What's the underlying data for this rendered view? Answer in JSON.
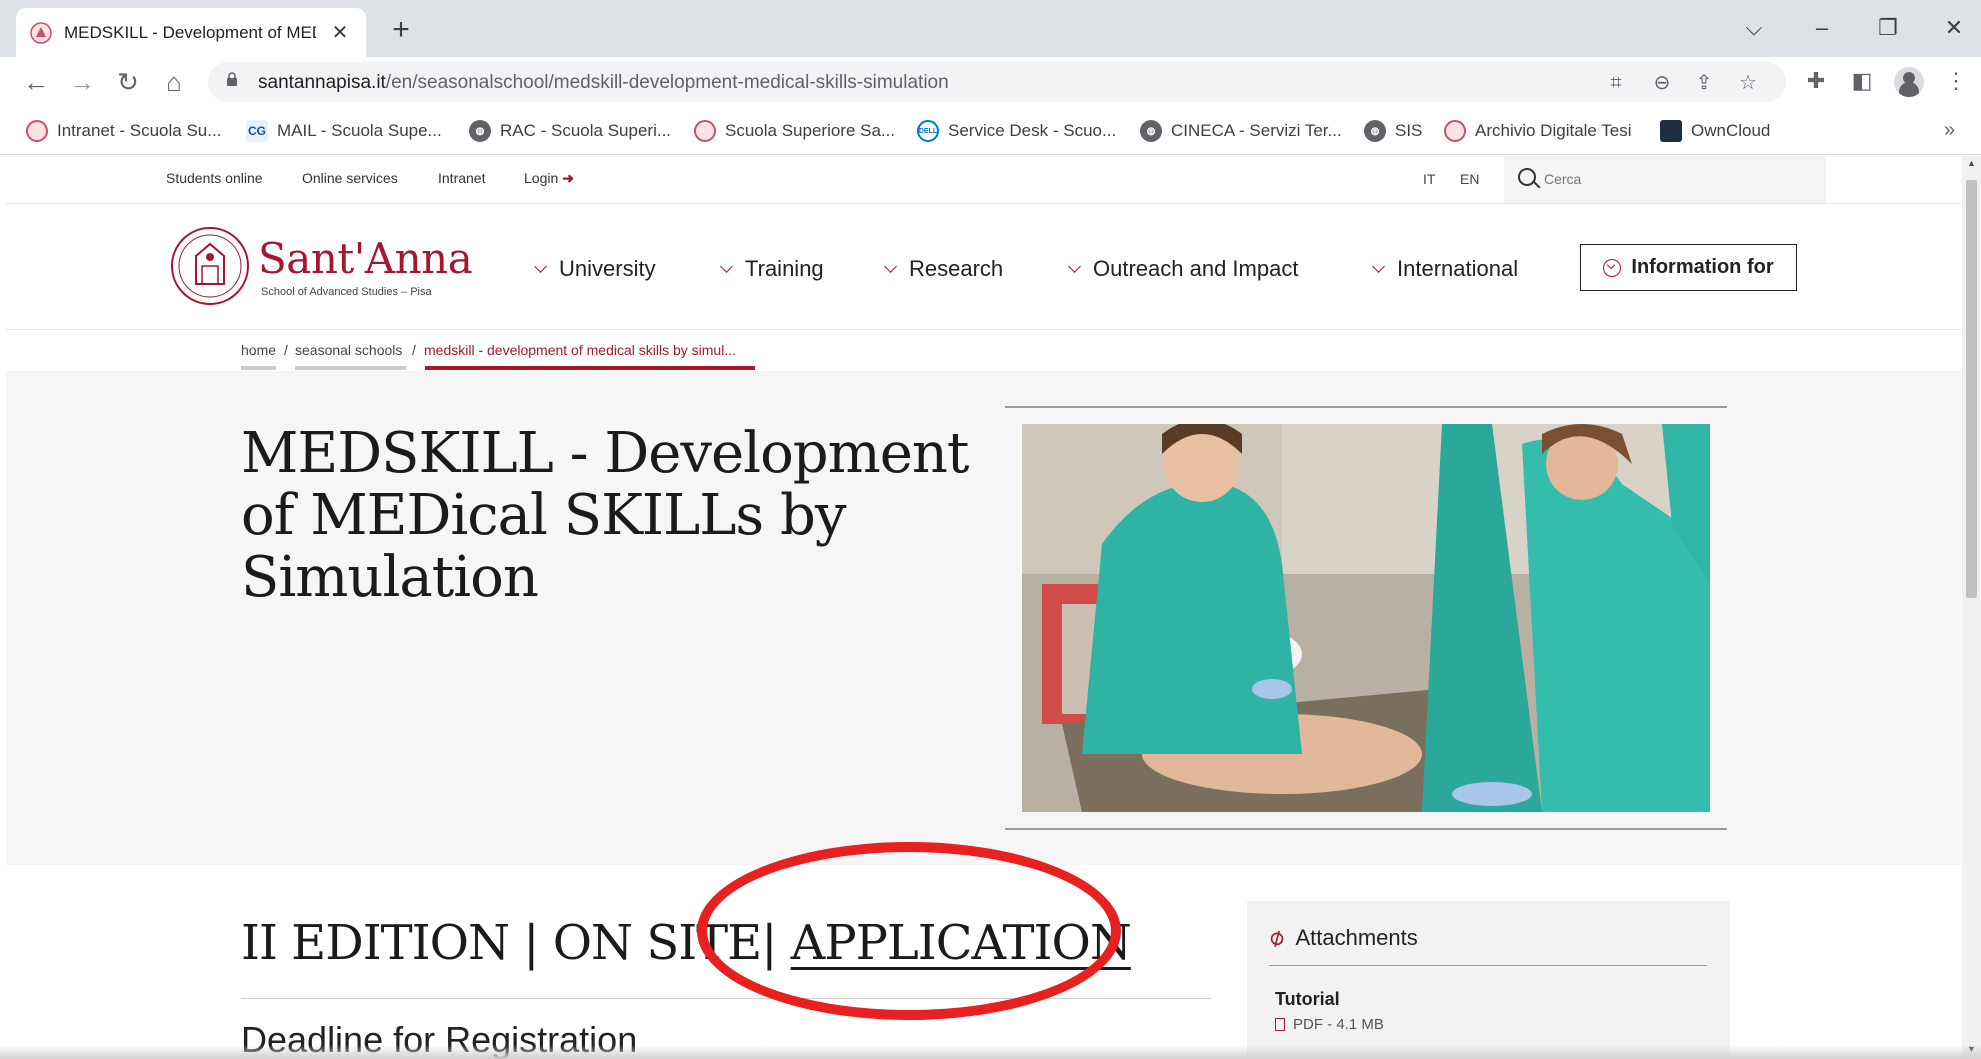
{
  "browser": {
    "tab_title": "MEDSKILL - Development of MEDSKILL",
    "url_host": "santannapisa.it",
    "url_path": "/en/seasonalschool/medskill-development-medical-skills-simulation",
    "bookmarks": [
      {
        "label": "Intranet - Scuola Su...",
        "icon": "crest-icon"
      },
      {
        "label": "MAIL - Scuola Supe...",
        "icon": "mail-icon"
      },
      {
        "label": "RAC - Scuola Superi...",
        "icon": "globe-icon"
      },
      {
        "label": "Scuola Superiore Sa...",
        "icon": "crest-icon"
      },
      {
        "label": "Service Desk - Scuo...",
        "icon": "dell-icon"
      },
      {
        "label": "CINECA - Servizi Ter...",
        "icon": "globe-icon"
      },
      {
        "label": "SIS",
        "icon": "globe-icon"
      },
      {
        "label": "Archivio Digitale Tesi",
        "icon": "crest-icon"
      },
      {
        "label": "OwnCloud",
        "icon": "cloud-icon"
      }
    ],
    "more_label": "»"
  },
  "utility": {
    "students_online": "Students online",
    "online_services": "Online services",
    "intranet": "Intranet",
    "login": "Login",
    "lang_it": "IT",
    "lang_en": "EN",
    "search_placeholder": "Cerca"
  },
  "logo": {
    "name": "Sant'Anna",
    "subtitle": "School of Advanced Studies – Pisa"
  },
  "menu": [
    {
      "label": "University"
    },
    {
      "label": "Training"
    },
    {
      "label": "Research"
    },
    {
      "label": "Outreach and Impact"
    },
    {
      "label": "International"
    }
  ],
  "info_button": "Information for",
  "breadcrumb": {
    "home": "home",
    "seasonal": "seasonal schools",
    "current": "medskill - development of medical skills by simul...",
    "separator": "/"
  },
  "hero": {
    "title": "MEDSKILL - Development of MEDical SKILLs by Simulation"
  },
  "edition": {
    "part1": "II EDITION",
    "part2": "ON SITE",
    "part3": "APPLICATION",
    "separator": "|"
  },
  "deadline_heading": "Deadline for Registration",
  "attachments": {
    "heading": "Attachments",
    "items": [
      {
        "title": "Tutorial",
        "meta": "PDF - 4.1 MB"
      }
    ]
  },
  "colors": {
    "brand": "#a3172f",
    "annotation": "#e8201f"
  }
}
